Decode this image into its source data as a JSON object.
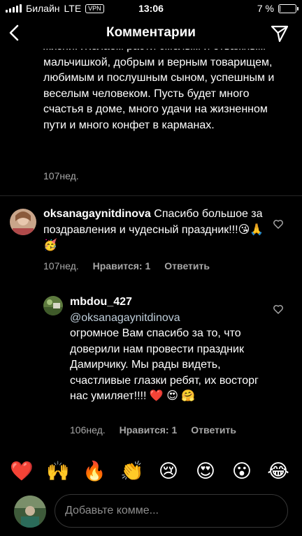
{
  "status_bar": {
    "carrier": "Билайн",
    "network": "LTE",
    "vpn": "VPN",
    "time": "13:06",
    "battery_text": "7 %",
    "battery_level": 0.07
  },
  "header": {
    "title": "Комментарии"
  },
  "caption": {
    "text": "жизни. Желаем расти смелым и отважным мальчишкой, добрым и верным товарищем, любимым и послушным сыном, успешным и веселым человеком. Пусть будет много счастья в доме, много удачи на жизненном пути и много конфет в карманах.",
    "time": "107нед."
  },
  "comments": [
    {
      "username": "oksanagaynitdinova",
      "text": "Спасибо большое за поздравления и чудесный праздник!!!😘🙏🥳",
      "time": "107нед.",
      "likes": "Нравится: 1",
      "reply_label": "Ответить"
    },
    {
      "username": "mbdou_427",
      "mention": "@oksanagaynitdinova",
      "text": "огромное Вам спасибо за то, что доверили нам провести праздник Дамирчику. Мы рады видеть, счастливые глазки ребят, их восторг нас умиляет!!!! ❤️ 😍 🤗",
      "time": "106нед.",
      "likes": "Нравится: 1",
      "reply_label": "Ответить"
    }
  ],
  "quick_reactions": [
    "❤️",
    "🙌",
    "🔥",
    "👏",
    "😢",
    "😍",
    "😮",
    "😂"
  ],
  "composer": {
    "placeholder": "Добавьте комме..."
  }
}
